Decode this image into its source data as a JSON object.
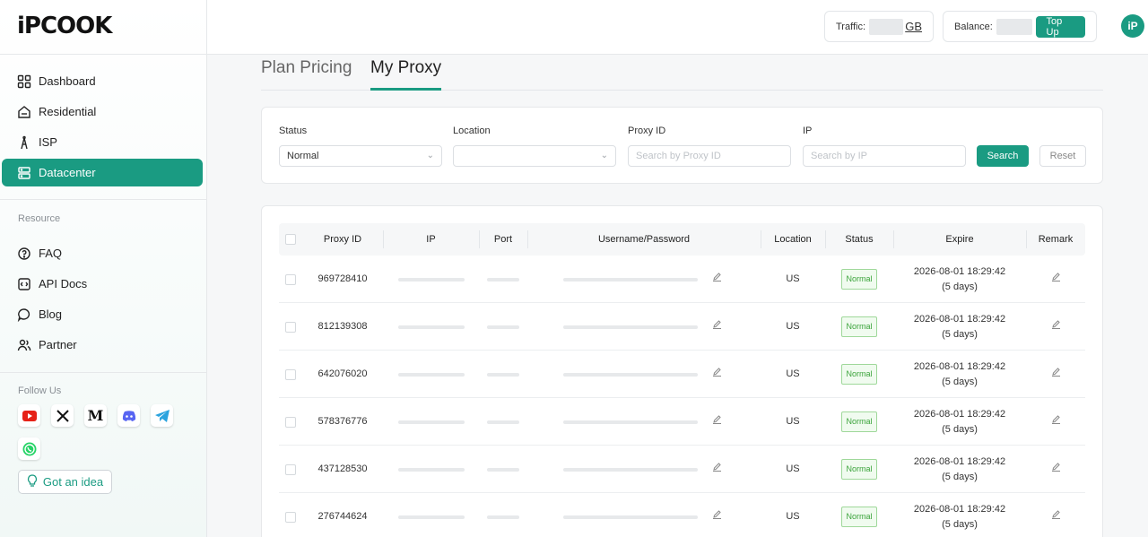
{
  "brand": {
    "logo_text": "iPCOOK",
    "accent": "#1a9b82"
  },
  "sidebar": {
    "nav": [
      {
        "label": "Dashboard",
        "icon": "grid-icon",
        "active": false
      },
      {
        "label": "Residential",
        "icon": "home-icon",
        "active": false
      },
      {
        "label": "ISP",
        "icon": "tower-icon",
        "active": false
      },
      {
        "label": "Datacenter",
        "icon": "server-icon",
        "active": true
      }
    ],
    "resource_label": "Resource",
    "resources": [
      {
        "label": "FAQ",
        "icon": "question-icon"
      },
      {
        "label": "API Docs",
        "icon": "code-icon"
      },
      {
        "label": "Blog",
        "icon": "chat-icon"
      },
      {
        "label": "Partner",
        "icon": "users-icon"
      }
    ],
    "follow_label": "Follow Us",
    "social": [
      "youtube-icon",
      "x-icon",
      "medium-icon",
      "discord-icon",
      "telegram-icon",
      "whatsapp-icon"
    ],
    "idea_button": "Got an idea"
  },
  "topbar": {
    "traffic_label": "Traffic:",
    "traffic_unit": "GB",
    "balance_label": "Balance:",
    "topup_label": "Top Up",
    "avatar_text": "iP"
  },
  "tabs": [
    {
      "label": "Plan Pricing",
      "active": false
    },
    {
      "label": "My Proxy",
      "active": true
    }
  ],
  "filters": {
    "status_label": "Status",
    "status_value": "Normal",
    "location_label": "Location",
    "location_value": "",
    "proxy_id_label": "Proxy ID",
    "proxy_id_placeholder": "Search by Proxy ID",
    "ip_label": "IP",
    "ip_placeholder": "Search by IP",
    "search_label": "Search",
    "reset_label": "Reset"
  },
  "table": {
    "columns": [
      "Proxy ID",
      "IP",
      "Port",
      "Username/Password",
      "Location",
      "Status",
      "Expire",
      "Remark"
    ],
    "rows": [
      {
        "proxy_id": "969728410",
        "location": "US",
        "status": "Normal",
        "expire": "2026-08-01 18:29:42",
        "expire_note": "(5 days)"
      },
      {
        "proxy_id": "812139308",
        "location": "US",
        "status": "Normal",
        "expire": "2026-08-01 18:29:42",
        "expire_note": "(5 days)"
      },
      {
        "proxy_id": "642076020",
        "location": "US",
        "status": "Normal",
        "expire": "2026-08-01 18:29:42",
        "expire_note": "(5 days)"
      },
      {
        "proxy_id": "578376776",
        "location": "US",
        "status": "Normal",
        "expire": "2026-08-01 18:29:42",
        "expire_note": "(5 days)"
      },
      {
        "proxy_id": "437128530",
        "location": "US",
        "status": "Normal",
        "expire": "2026-08-01 18:29:42",
        "expire_note": "(5 days)"
      },
      {
        "proxy_id": "276744624",
        "location": "US",
        "status": "Normal",
        "expire": "2026-08-01 18:29:42",
        "expire_note": "(5 days)"
      }
    ]
  }
}
